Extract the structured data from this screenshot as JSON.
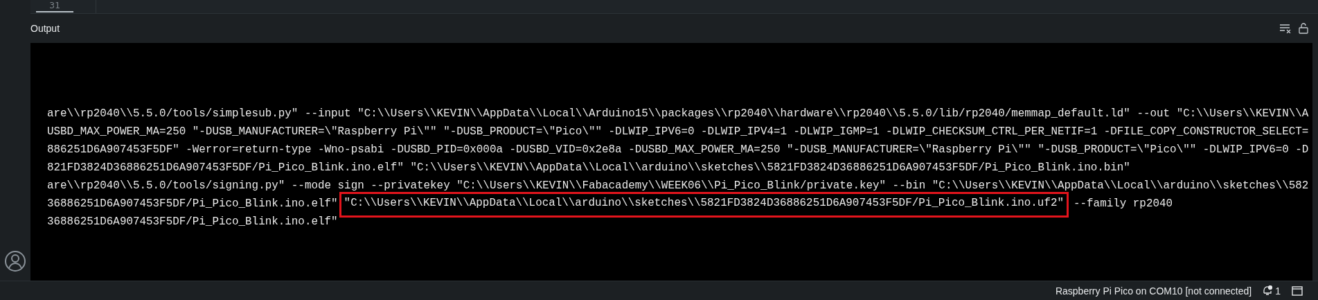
{
  "editor": {
    "line_number": "31"
  },
  "output": {
    "title": "Output",
    "lines": [
      {
        "segments": [
          {
            "text": "are\\\\rp2040\\\\5.5.0/tools/simplesub.py\" --input \"C:\\\\Users\\\\KEVIN\\\\AppData\\\\Local\\\\Arduino15\\\\packages\\\\rp2040\\\\hardware\\\\rp2040\\\\5.5.0/lib/rp2040/memmap_default.ld\" --out \"C:\\\\Users\\\\KEVIN\\\\A",
            "highlighted": false
          }
        ]
      },
      {
        "segments": [
          {
            "text": "USBD_MAX_POWER_MA=250 \"-DUSB_MANUFACTURER=\\\"Raspberry Pi\\\"\" \"-DUSB_PRODUCT=\\\"Pico\\\"\" -DLWIP_IPV6=0 -DLWIP_IPV4=1 -DLWIP_IGMP=1 -DLWIP_CHECKSUM_CTRL_PER_NETIF=1 -DFILE_COPY_CONSTRUCTOR_SELECT=",
            "highlighted": false
          }
        ]
      },
      {
        "segments": [
          {
            "text": "886251D6A907453F5DF\" -Werror=return-type -Wno-psabi -DUSBD_PID=0x000a -DUSBD_VID=0x2e8a -DUSBD_MAX_POWER_MA=250 \"-DUSB_MANUFACTURER=\\\"Raspberry Pi\\\"\" \"-DUSB_PRODUCT=\\\"Pico\\\"\" -DLWIP_IPV6=0 -D",
            "highlighted": false
          }
        ]
      },
      {
        "segments": [
          {
            "text": "821FD3824D36886251D6A907453F5DF/Pi_Pico_Blink.ino.elf\" \"C:\\\\Users\\\\KEVIN\\\\AppData\\\\Local\\\\arduino\\\\sketches\\\\5821FD3824D36886251D6A907453F5DF/Pi_Pico_Blink.ino.bin\"",
            "highlighted": false
          }
        ]
      },
      {
        "segments": [
          {
            "text": "are\\\\rp2040\\\\5.5.0/tools/signing.py\" --mode sign --privatekey \"C:\\\\Users\\\\KEVIN\\\\Fabacademy\\\\WEEK06\\\\Pi_Pico_Blink/private.key\" --bin \"C:\\\\Users\\\\KEVIN\\\\AppData\\\\Local\\\\arduino\\\\sketches\\\\582",
            "highlighted": false
          }
        ]
      },
      {
        "segments": [
          {
            "text": "36886251D6A907453F5DF/Pi_Pico_Blink.ino.elf\"",
            "highlighted": false
          },
          {
            "text": "\"C:\\\\Users\\\\KEVIN\\\\AppData\\\\Local\\\\arduino\\\\sketches\\\\5821FD3824D36886251D6A907453F5DF/Pi_Pico_Blink.ino.uf2\"",
            "highlighted": true
          },
          {
            "text": "--family rp2040",
            "highlighted": false
          }
        ]
      },
      {
        "segments": [
          {
            "text": "36886251D6A907453F5DF/Pi_Pico_Blink.ino.elf\"",
            "highlighted": false
          }
        ]
      }
    ]
  },
  "status_bar": {
    "board": "Raspberry Pi Pico on COM10 [not connected]",
    "notifications": "1"
  }
}
